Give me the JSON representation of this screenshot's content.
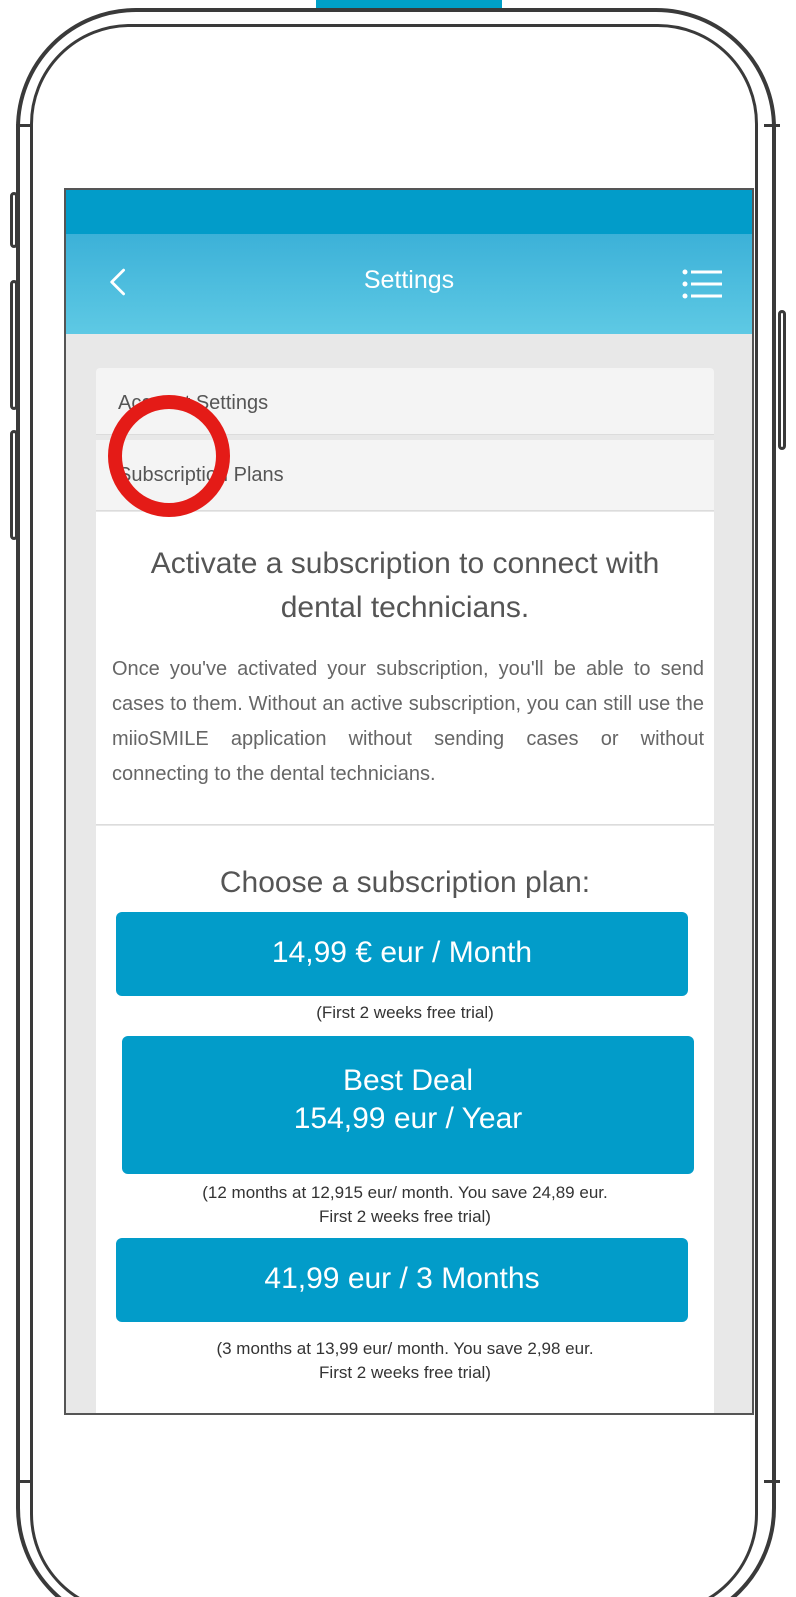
{
  "header": {
    "title": "Settings"
  },
  "icons": {
    "back": "chevron-left-icon",
    "menu": "list-menu-icon"
  },
  "sections": {
    "account_settings": "Account Settings",
    "subscription_plans": "Subscription Plans"
  },
  "intro": {
    "headline": "Activate a subscription to connect with dental technicians.",
    "body": "Once you've activated your subscription, you'll be able to send cases to them. Without an active subscription, you can still use the miioSMILE application without sending cases or without connecting to the dental technicians."
  },
  "plans": {
    "heading": "Choose a subscription plan:",
    "monthly": {
      "label": "14,99 € eur / Month",
      "note": "(First 2 weeks free trial)"
    },
    "yearly": {
      "badge": "Best Deal",
      "label": "154,99  eur / Year",
      "note_line1": "(12 months at 12,915 eur/ month. You save 24,89 eur.",
      "note_line2": "First 2 weeks free trial)"
    },
    "quarterly": {
      "label": "41,99 eur / 3 Months",
      "note_line1": "(3 months at 13,99 eur/ month. You save 2,98 eur.",
      "note_line2": "First 2 weeks free trial)"
    }
  },
  "colors": {
    "accent": "#029cc9",
    "header_top": "#3cb1d8",
    "header_bottom": "#5ec9e4",
    "highlight_circle": "#e41b17"
  }
}
